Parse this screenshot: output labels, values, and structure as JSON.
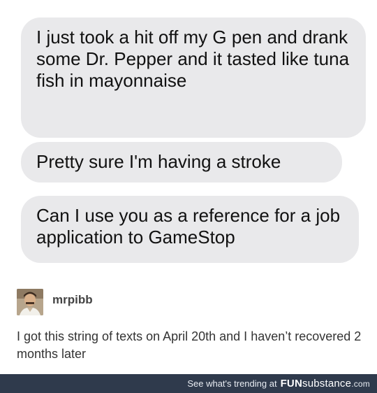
{
  "messages": [
    {
      "text": "I just took a hit off my G pen and drank some Dr. Pepper and it tasted like tuna fish in mayonnaise"
    },
    {
      "text": "Pretty sure I'm having a stroke"
    },
    {
      "text": "Can I use you as a reference for a job application to GameStop"
    }
  ],
  "post": {
    "username": "mrpibb",
    "body": "I got this string of texts on April 20th and I haven’t recovered 2 months later"
  },
  "footer": {
    "trending_text": "See what's trending at",
    "brand_bold": "FUN",
    "brand_light": "substance",
    "brand_tld": ".com",
    "background_color": "#2f3a4c"
  },
  "colors": {
    "bubble": "#e9e9eb",
    "text": "#111111"
  }
}
